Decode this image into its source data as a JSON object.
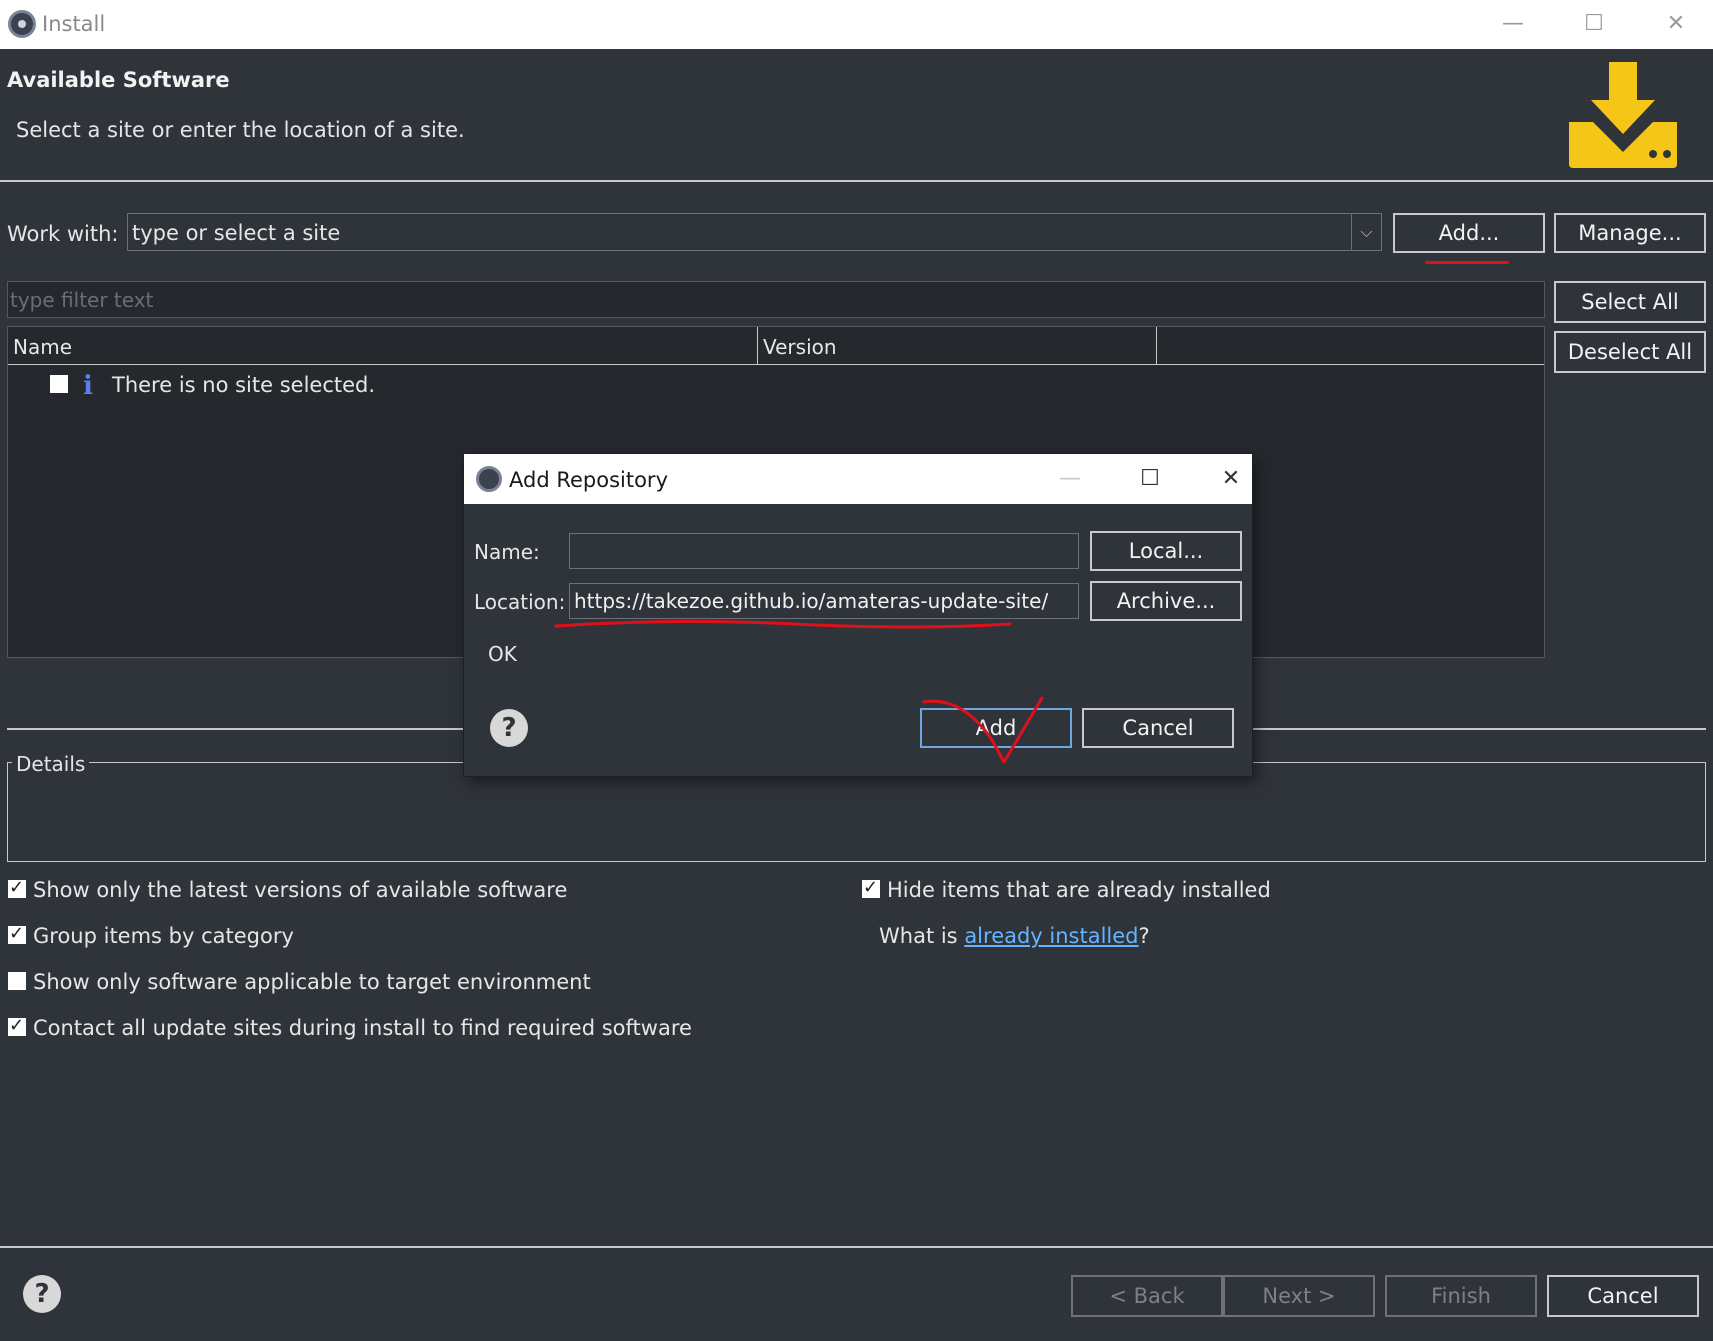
{
  "window": {
    "title": "Install",
    "minimize": "—",
    "maximize": "☐",
    "close": "✕"
  },
  "header": {
    "title": "Available Software",
    "subtitle": "Select a site or enter the location of a site."
  },
  "work_with": {
    "label": "Work with:",
    "value": "type or select a site",
    "add_label": "Add...",
    "manage_label": "Manage..."
  },
  "filter": {
    "placeholder": "type filter text"
  },
  "side_buttons": {
    "select_all": "Select All",
    "deselect_all": "Deselect All"
  },
  "table": {
    "columns": [
      "Name",
      "Version"
    ],
    "rows": [
      {
        "text": "There is no site selected.",
        "checked": false
      }
    ]
  },
  "details": {
    "label": "Details"
  },
  "options": {
    "left": [
      {
        "label": "Show only the latest versions of available software",
        "checked": true
      },
      {
        "label": "Group items by category",
        "checked": true
      },
      {
        "label": "Show only software applicable to target environment",
        "checked": false
      },
      {
        "label": "Contact all update sites during install to find required software",
        "checked": true
      }
    ],
    "right": [
      {
        "label": "Hide items that are already installed",
        "checked": true
      }
    ],
    "what_is_prefix": "What is ",
    "already_installed_link": "already installed",
    "what_is_suffix": "?"
  },
  "footer": {
    "back": "< Back",
    "next": "Next >",
    "finish": "Finish",
    "cancel": "Cancel"
  },
  "dialog": {
    "title": "Add Repository",
    "name_label": "Name:",
    "name_value": "",
    "location_label": "Location:",
    "location_value": "https://takezoe.github.io/amateras-update-site/",
    "local_button": "Local...",
    "archive_button": "Archive...",
    "status": "OK",
    "add_button": "Add",
    "cancel_button": "Cancel"
  },
  "colors": {
    "background": "#2f343a",
    "accent_icon": "#f5c518",
    "annotation": "#e0101a",
    "link": "#66b3ff"
  }
}
